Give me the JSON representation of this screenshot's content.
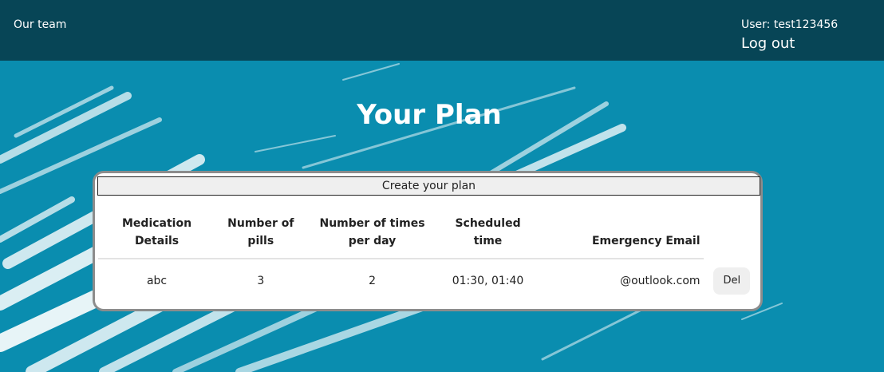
{
  "header": {
    "brand": "Our team",
    "user_label": "User: test123456",
    "logout_label": "Log out"
  },
  "page": {
    "title": "Your Plan"
  },
  "plan": {
    "header_label": "Create your plan",
    "columns": [
      "Medication Details",
      "Number of pills",
      "Number of times per day",
      "Scheduled time",
      "Emergency Email",
      ""
    ],
    "rows": [
      {
        "medication": "abc",
        "pills": "3",
        "times_per_day": "2",
        "scheduled_time": "01:30, 01:40",
        "email": "@outlook.com",
        "delete_label": "Del"
      }
    ]
  },
  "colors": {
    "topbar": "#074556",
    "background": "#0a8daf",
    "card_border": "#8c8c8c"
  }
}
